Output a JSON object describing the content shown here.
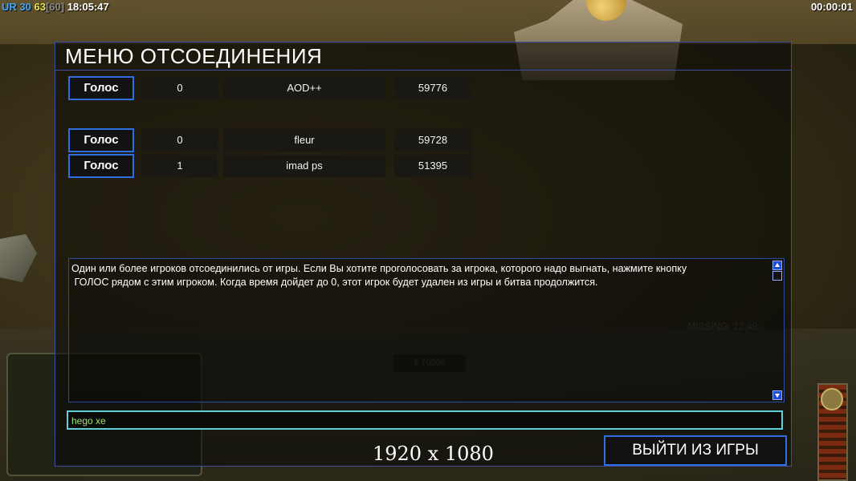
{
  "status": {
    "ur_label": "UR",
    "ur_value": "30",
    "fps": "63",
    "fps_limit": "[60]",
    "clock": "18:05:47",
    "timer": "00:00:01"
  },
  "dialog": {
    "title": "МЕНЮ ОТСОЕДИНЕНИЯ",
    "players": [
      {
        "vote_label": "Голос",
        "votes": "0",
        "name": "AOD++",
        "ping": "59776"
      },
      {
        "vote_label": "Голос",
        "votes": "0",
        "name": "fleur",
        "ping": "59728"
      },
      {
        "vote_label": "Голос",
        "votes": "1",
        "name": "imad ps",
        "ping": "51395"
      }
    ],
    "message": "Один или более игроков отсоединились от игры. Если Вы хотите проголосовать за игрока, которого надо выгнать, нажмите кнопку\n ГОЛОС рядом с этим игроком. Когда время дойдет до 0, этот игрок будет удален из игры и битва продолжится.",
    "chat_value": "hego xe",
    "exit_label": "ВЫЙТИ ИЗ ИГРЫ",
    "resolution": "1920 x 1080"
  },
  "background": {
    "money": "$ 70000",
    "missing": "MISSING: 12:49"
  }
}
